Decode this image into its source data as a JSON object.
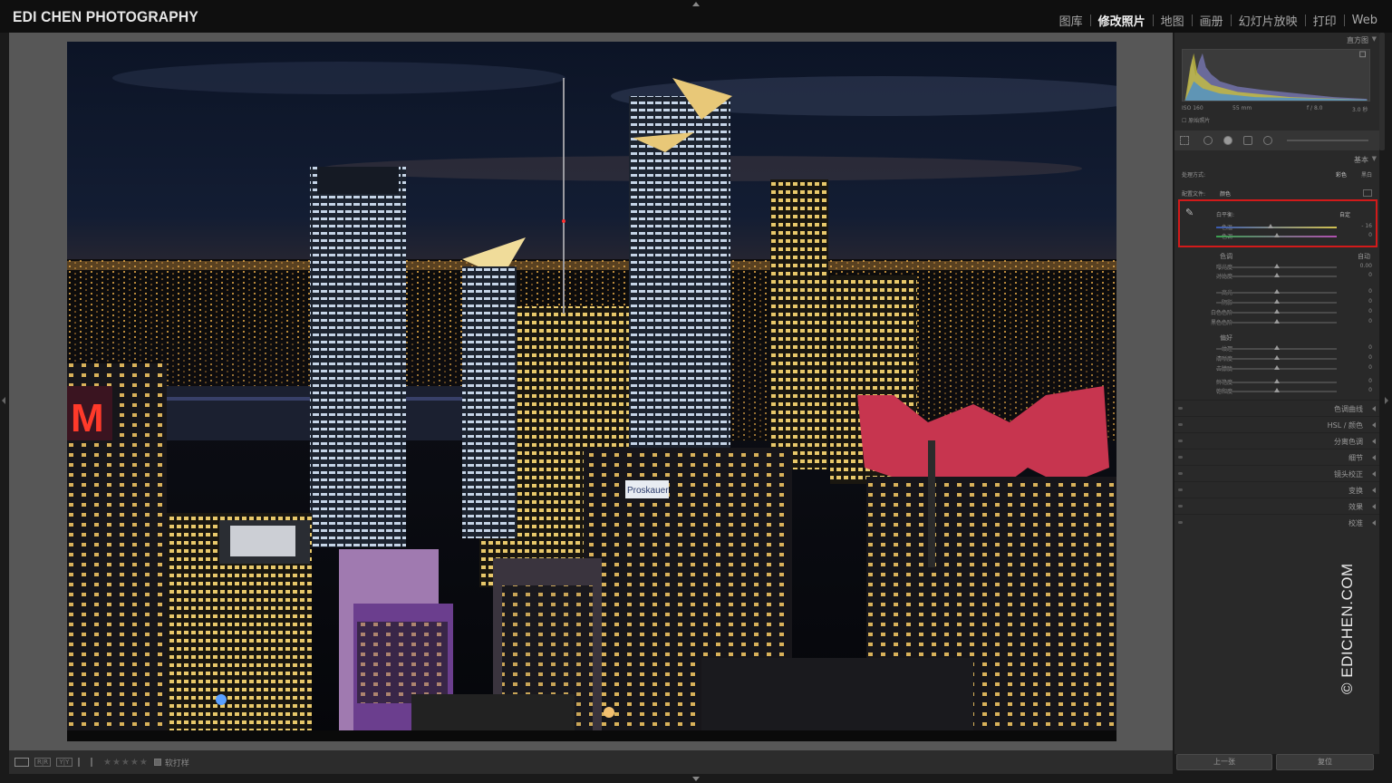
{
  "app": {
    "identity_plate": "EDI CHEN PHOTOGRAPHY"
  },
  "modules": [
    {
      "label": "图库",
      "active": false
    },
    {
      "label": "修改照片",
      "active": true
    },
    {
      "label": "地图",
      "active": false
    },
    {
      "label": "画册",
      "active": false
    },
    {
      "label": "幻灯片放映",
      "active": false
    },
    {
      "label": "打印",
      "active": false
    },
    {
      "label": "Web",
      "active": false
    }
  ],
  "toolbar": {
    "soft_proof_label": "软打样",
    "stars": "★★★★★"
  },
  "right_panel": {
    "histogram": {
      "title": "直方图",
      "iso": "ISO 160",
      "focal": "55 mm",
      "aperture": "f / 8.0",
      "shutter": "3.0 秒",
      "original_photo_label": "原始照片"
    },
    "basic": {
      "title": "基本",
      "treatment_label": "处理方式:",
      "treatment_color": "彩色",
      "treatment_bw": "黑白",
      "profile_label": "配置文件:",
      "profile_value": "颜色",
      "white_balance_label": "白平衡:",
      "white_balance_value": "自定",
      "wb_rows": [
        {
          "label": "色温",
          "value": "- 16",
          "knob": 0.45
        },
        {
          "label": "色调",
          "value": "0",
          "knob": 0.5
        }
      ],
      "tone_label": "色调",
      "tone_auto": "自动",
      "tone_rows": [
        {
          "label": "曝光度",
          "value": "0.00",
          "knob": 0.5
        },
        {
          "label": "对比度",
          "value": "0",
          "knob": 0.5
        }
      ],
      "light_rows": [
        {
          "label": "高光",
          "value": "0",
          "knob": 0.5
        },
        {
          "label": "阴影",
          "value": "0",
          "knob": 0.5
        },
        {
          "label": "白色色阶",
          "value": "0",
          "knob": 0.5
        },
        {
          "label": "黑色色阶",
          "value": "0",
          "knob": 0.5
        }
      ],
      "presence_label": "偏好",
      "presence_rows": [
        {
          "label": "纹理",
          "value": "0",
          "knob": 0.5
        },
        {
          "label": "清晰度",
          "value": "0",
          "knob": 0.5
        },
        {
          "label": "去朦胧",
          "value": "0",
          "knob": 0.5
        }
      ],
      "sat_rows": [
        {
          "label": "鲜艳度",
          "value": "0",
          "knob": 0.5
        },
        {
          "label": "饱和度",
          "value": "0",
          "knob": 0.5
        }
      ]
    },
    "collapsed_panels": [
      "色调曲线",
      "HSL / 颜色",
      "分离色调",
      "细节",
      "镜头校正",
      "变换",
      "效果",
      "校准"
    ],
    "buttons": {
      "previous": "上一张",
      "reset": "复位"
    }
  },
  "watermark": "© EDICHEN.COM",
  "photo_sign": "Proskauer",
  "colors": {
    "highlight_box": "#d21a1a",
    "panel_bg": "#292929",
    "canvas_bg": "#575757"
  }
}
